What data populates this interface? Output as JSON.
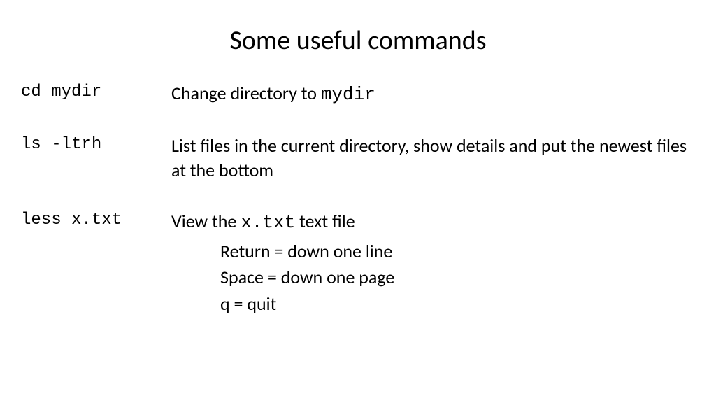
{
  "title": "Some useful commands",
  "rows": [
    {
      "cmd": "cd mydir",
      "desc_pre": "Change directory to ",
      "desc_mono": "mydir",
      "desc_post": ""
    },
    {
      "cmd": "ls -ltrh",
      "desc_pre": "List files in the current directory, show details and put the newest files at the bottom",
      "desc_mono": "",
      "desc_post": ""
    },
    {
      "cmd": "less x.txt",
      "desc_pre": "View the ",
      "desc_mono": "x.txt",
      "desc_post": " text file",
      "sub": [
        "Return = down one line",
        "Space = down one page",
        "q = quit"
      ]
    }
  ]
}
